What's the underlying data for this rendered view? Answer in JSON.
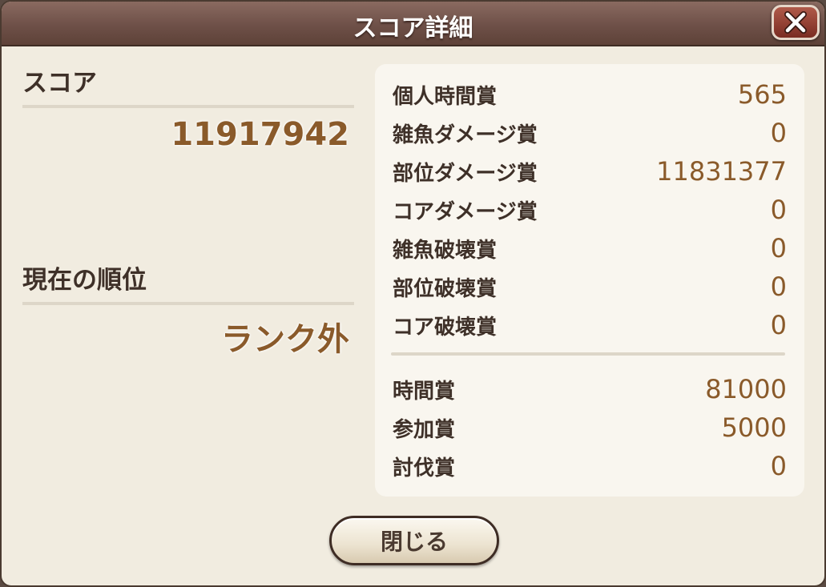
{
  "dialog": {
    "title": "スコア詳細",
    "close_icon": "close-x-icon",
    "close_button_label": "閉じる"
  },
  "score": {
    "label": "スコア",
    "value": "11917942"
  },
  "rank": {
    "label": "現在の順位",
    "value": "ランク外"
  },
  "breakdown": [
    {
      "label": "個人時間賞",
      "value": "565"
    },
    {
      "label": "雑魚ダメージ賞",
      "value": "0"
    },
    {
      "label": "部位ダメージ賞",
      "value": "11831377"
    },
    {
      "label": "コアダメージ賞",
      "value": "0"
    },
    {
      "label": "雑魚破壊賞",
      "value": "0"
    },
    {
      "label": "部位破壊賞",
      "value": "0"
    },
    {
      "label": "コア破壊賞",
      "value": "0"
    }
  ],
  "bonus": [
    {
      "label": "時間賞",
      "value": "81000"
    },
    {
      "label": "参加賞",
      "value": "5000"
    },
    {
      "label": "討伐賞",
      "value": "0"
    }
  ],
  "colors": {
    "value_text": "#8a5a2a",
    "label_text": "#3e3028",
    "titlebar": "#6e5048",
    "background": "#f1ece0"
  }
}
